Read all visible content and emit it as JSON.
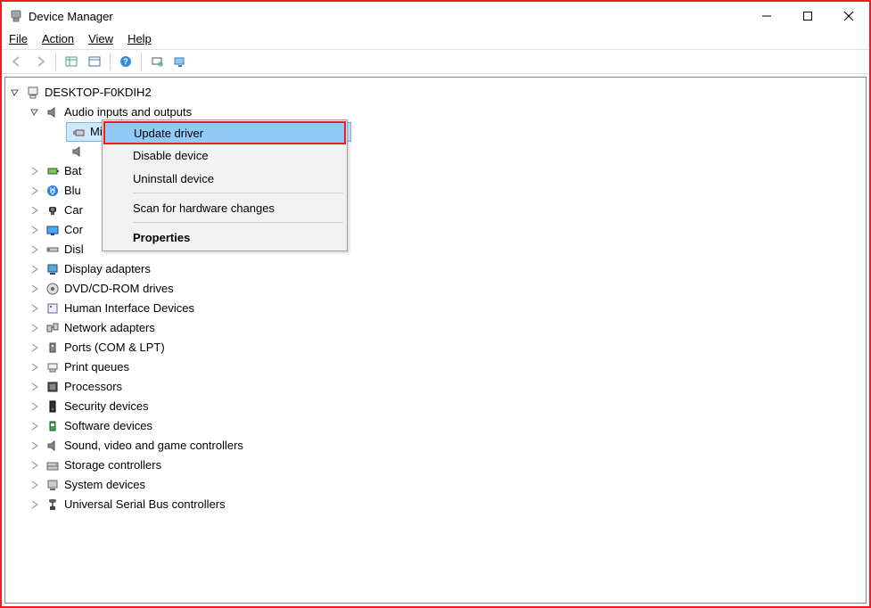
{
  "window": {
    "title": "Device Manager"
  },
  "menubar": {
    "file": "File",
    "action": "Action",
    "view": "View",
    "help": "Help"
  },
  "tree": {
    "root": "DESKTOP-F0KDIH2",
    "audio_category": "Audio inputs and outputs",
    "selected_device": "Mi",
    "secondary_device_prefix": "",
    "categories": [
      "Bat",
      "Blu",
      "Car",
      "Cor",
      "Disl",
      "Display adapters",
      "DVD/CD-ROM drives",
      "Human Interface Devices",
      "Network adapters",
      "Ports (COM & LPT)",
      "Print queues",
      "Processors",
      "Security devices",
      "Software devices",
      "Sound, video and game controllers",
      "Storage controllers",
      "System devices",
      "Universal Serial Bus controllers"
    ]
  },
  "context_menu": {
    "update": "Update driver",
    "disable": "Disable device",
    "uninstall": "Uninstall device",
    "scan": "Scan for hardware changes",
    "properties": "Properties"
  },
  "icons": {
    "computer": "computer-icon",
    "audio": "speaker-icon",
    "microphone": "microphone-icon",
    "battery": "battery-icon",
    "bluetooth": "bluetooth-icon",
    "camera": "camera-icon",
    "monitor": "monitor-icon",
    "disk": "disk-icon",
    "display": "display-adapter-icon",
    "dvd": "dvd-icon",
    "hid": "hid-icon",
    "network": "network-icon",
    "ports": "ports-icon",
    "printer": "printer-icon",
    "processor": "processor-icon",
    "security": "security-icon",
    "software": "software-icon",
    "sound": "sound-icon",
    "storage": "storage-icon",
    "system": "system-icon",
    "usb": "usb-icon"
  }
}
